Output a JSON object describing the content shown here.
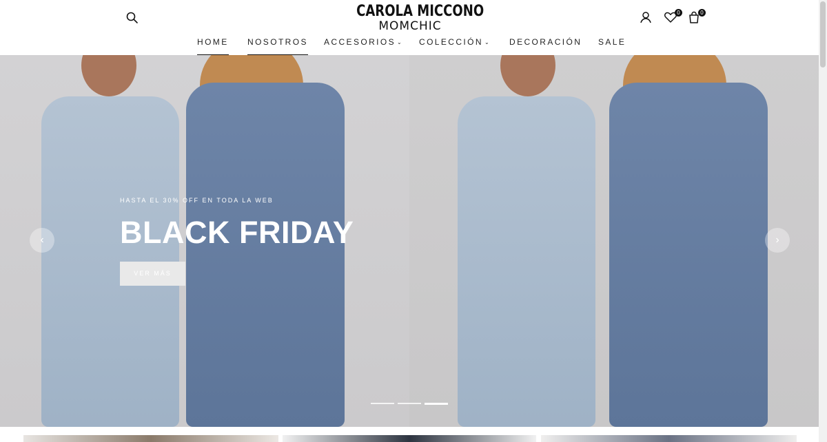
{
  "header": {
    "logo_top": "CAROLA MICCONO",
    "logo_bottom": "MOMCHIC",
    "wishlist_count": "0",
    "cart_count": "0"
  },
  "nav": {
    "items": [
      {
        "label": "HOME",
        "active": true
      },
      {
        "label": "NOSOTROS",
        "active": true
      },
      {
        "label": "ACCESORIOS",
        "dropdown": true
      },
      {
        "label": "COLECCIÓN",
        "dropdown": true
      },
      {
        "label": "DECORACIÓN"
      },
      {
        "label": "SALE"
      }
    ]
  },
  "hero": {
    "subtitle": "HASTA EL 30% OFF EN TODA LA WEB",
    "title": "BLACK FRIDAY",
    "button_label": "VER MÁS",
    "prev_icon": "‹",
    "next_icon": "›",
    "slide_count": 3,
    "active_slide": 3
  },
  "icons": [
    "search-icon",
    "user-icon",
    "heart-icon",
    "bag-icon",
    "chevron-left-icon",
    "chevron-right-icon"
  ]
}
